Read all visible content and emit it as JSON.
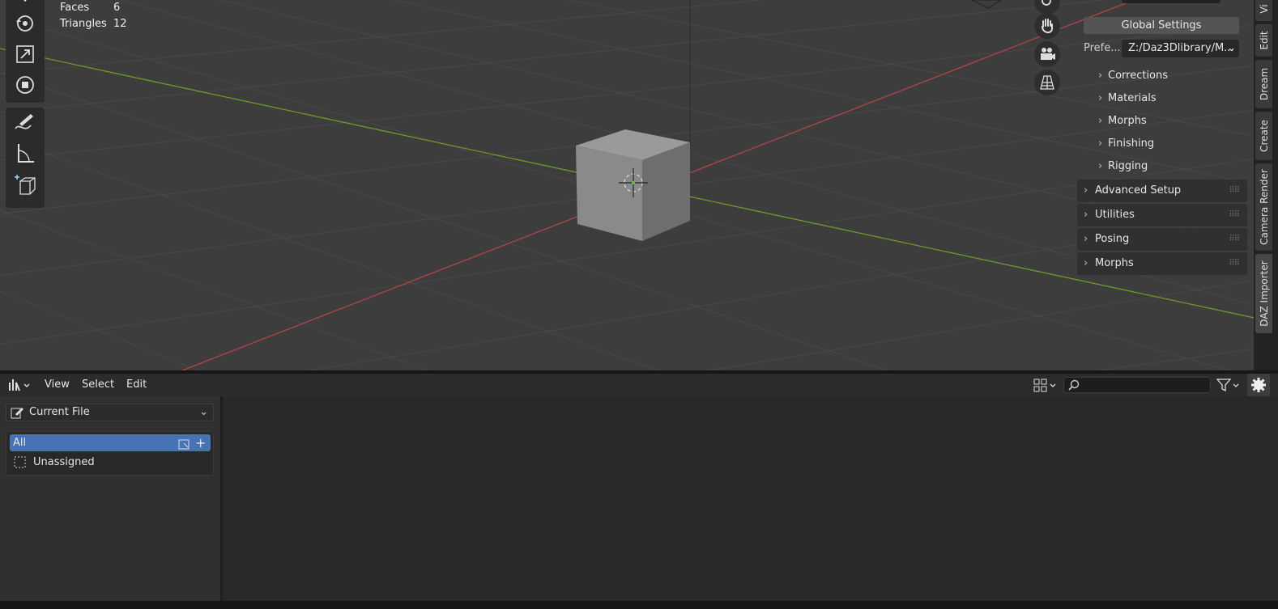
{
  "viewport": {
    "stats": [
      {
        "label": "Faces",
        "value": "6"
      },
      {
        "label": "Triangles",
        "value": "12"
      }
    ]
  },
  "tools": {
    "top": [
      "move-icon",
      "rotate-icon",
      "scale-icon",
      "transform-icon"
    ],
    "bottom": [
      "annotate-icon",
      "measure-icon",
      "add-cube-icon"
    ]
  },
  "nav_gizmo": [
    "zoom-icon",
    "hand-pan-icon",
    "camera-icon",
    "perspective-grid-icon"
  ],
  "npanel": {
    "global_settings": "Global Settings",
    "pref_label": "Prefe...",
    "pref_value": "Z:/Daz3Dlibrary/M...",
    "sub_items": [
      "Corrections",
      "Materials",
      "Morphs",
      "Finishing",
      "Rigging"
    ],
    "panels": [
      "Advanced Setup",
      "Utilities",
      "Posing",
      "Morphs"
    ]
  },
  "vertical_tabs": [
    "Vi",
    "Edit",
    "Dream",
    "Create",
    "Camera Render",
    "DAZ Importer"
  ],
  "outliner": {
    "menu": [
      "View",
      "Select",
      "Edit"
    ],
    "file_select": "Current File",
    "rows": {
      "all": "All",
      "unassigned": "Unassigned"
    },
    "search_placeholder": ""
  },
  "colors": {
    "selection": "#4772b3",
    "x_axis": "#b5434a",
    "y_axis": "#6d9a2a"
  }
}
